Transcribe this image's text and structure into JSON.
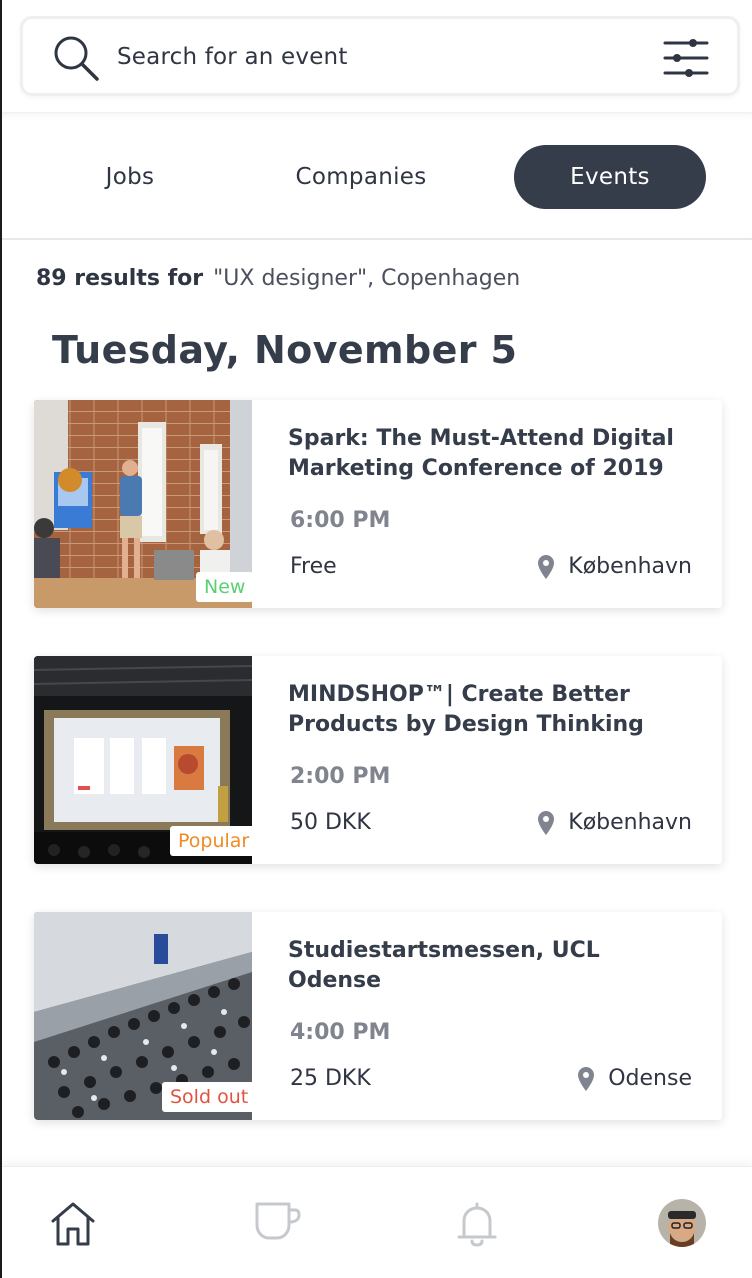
{
  "search": {
    "placeholder": "Search for an event"
  },
  "tabs": [
    {
      "label": "Jobs",
      "active": false
    },
    {
      "label": "Companies",
      "active": false
    },
    {
      "label": "Events",
      "active": true
    }
  ],
  "results": {
    "count_label": "89 results for",
    "query": "\"UX designer\", Copenhagen"
  },
  "day_title": "Tuesday, November 5",
  "events": [
    {
      "title": "Spark: The Must-Attend Digital Marketing Conference of 2019",
      "time": "6:00 PM",
      "price": "Free",
      "location": "København",
      "badge": "New",
      "badge_color": "#5ccf73"
    },
    {
      "title": "MINDSHOP™| Create Better Products by Design Thinking",
      "time": "2:00 PM",
      "price": "50 DKK",
      "location": "København",
      "badge": "Popular",
      "badge_color": "#f08a24"
    },
    {
      "title": "Studiestartsmessen, UCL Odense",
      "time": "4:00 PM",
      "price": "25 DKK",
      "location": "Odense",
      "badge": "Sold out",
      "badge_color": "#e0533f"
    }
  ],
  "bottom_nav": {
    "items": [
      {
        "icon": "home-icon",
        "active": true
      },
      {
        "icon": "coffee-cup-icon",
        "active": false
      },
      {
        "icon": "bell-icon",
        "active": false
      },
      {
        "icon": "profile-avatar",
        "active": false
      }
    ]
  },
  "colors": {
    "dark": "#353c4a",
    "muted": "#7f848e",
    "inactive_icon": "#c5c8cd"
  }
}
